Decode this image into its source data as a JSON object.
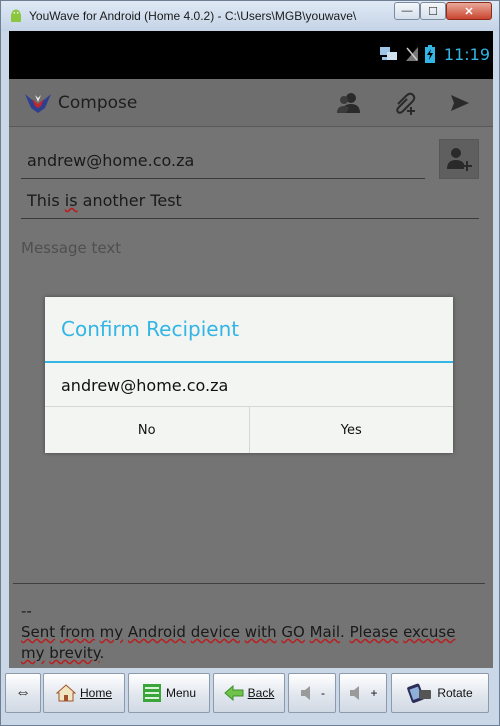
{
  "window": {
    "title": "YouWave for Android (Home 4.0.2) - C:\\Users\\MGB\\youwave\\",
    "minimize": "—",
    "maximize": "☐",
    "close": "✕"
  },
  "statusbar": {
    "time": "11:19"
  },
  "actionbar": {
    "title": "Compose",
    "icons": [
      "people-icon",
      "paperclip-icon",
      "send-icon"
    ]
  },
  "compose": {
    "to": "andrew@home.co.za",
    "subject_parts": [
      "This ",
      "is",
      " another Test"
    ],
    "message_placeholder": "Message text",
    "signature_separator": "--"
  },
  "dialog": {
    "title": "Confirm Recipient",
    "message": "andrew@home.co.za",
    "no_label": "No",
    "yes_label": "Yes"
  },
  "toolbar": {
    "swap": "⇔",
    "home": "Home",
    "menu": "Menu",
    "back": "Back",
    "vol_down": "-",
    "vol_up": "+",
    "rotate": "Rotate"
  },
  "colors": {
    "accent": "#33b5e5",
    "spell_underline": "#b81f1f"
  }
}
